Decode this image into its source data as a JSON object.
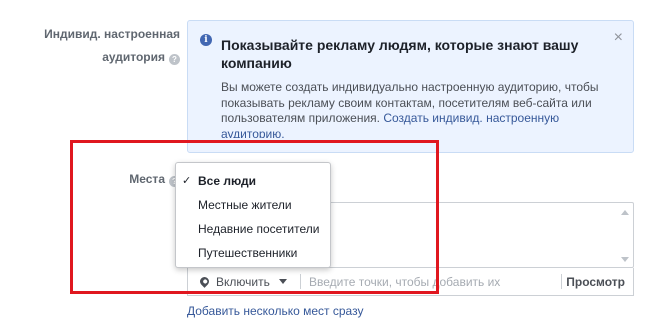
{
  "custom_audience": {
    "label_line1": "Индивид. настроенная",
    "label_line2": "аудитория",
    "help_icon": "question-icon"
  },
  "info_box": {
    "icon": "info-icon",
    "title": "Показывайте рекламу людям, которые знают вашу компанию",
    "body": "Вы можете создать индивидуально настроенную аудиторию, чтобы показывать рекламу своим контактам, посетителям веб-сайта или пользователям приложения.",
    "link": "Создать индивид. настроенную аудиторию.",
    "close_icon": "close-icon",
    "close_glyph": "×"
  },
  "locations": {
    "label": "Места",
    "help_icon": "question-icon",
    "dropdown": {
      "check_glyph": "✓",
      "options": [
        "Все люди",
        "Местные жители",
        "Недавние посетители",
        "Путешественники"
      ],
      "selected": "Все люди"
    },
    "include_button": "Включить",
    "input_placeholder": "Введите точки, чтобы добавить их",
    "browse": "Просмотр",
    "add_multiple": "Добавить несколько мест сразу"
  },
  "colors": {
    "info_bg": "#ecf3ff",
    "link": "#365899",
    "highlight": "#e0171f"
  }
}
